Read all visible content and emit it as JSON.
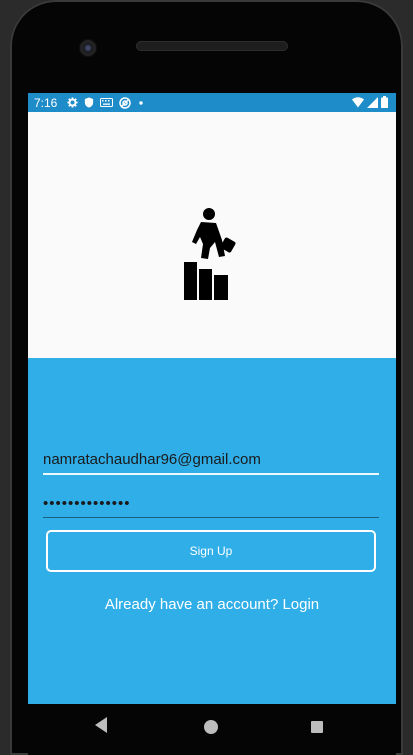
{
  "status_bar": {
    "time": "7:16",
    "left_icons": [
      "gear-icon",
      "shield-icon",
      "keyboard-icon",
      "at-sign-icon",
      "dot-icon"
    ],
    "right_icons": [
      "wifi-icon",
      "signal-icon",
      "battery-icon"
    ],
    "color": "#1e8cc9"
  },
  "logo": {
    "icon": "career-climb-icon"
  },
  "form": {
    "background": "#30aee8",
    "email_value": "namratachaudhar96@gmail.com",
    "password_value": "••••••••••••••",
    "signup_label": "Sign Up",
    "login_prompt": "Already have an account? Login"
  },
  "nav_bar": {
    "buttons": [
      "back-icon",
      "home-icon",
      "recents-icon"
    ]
  }
}
